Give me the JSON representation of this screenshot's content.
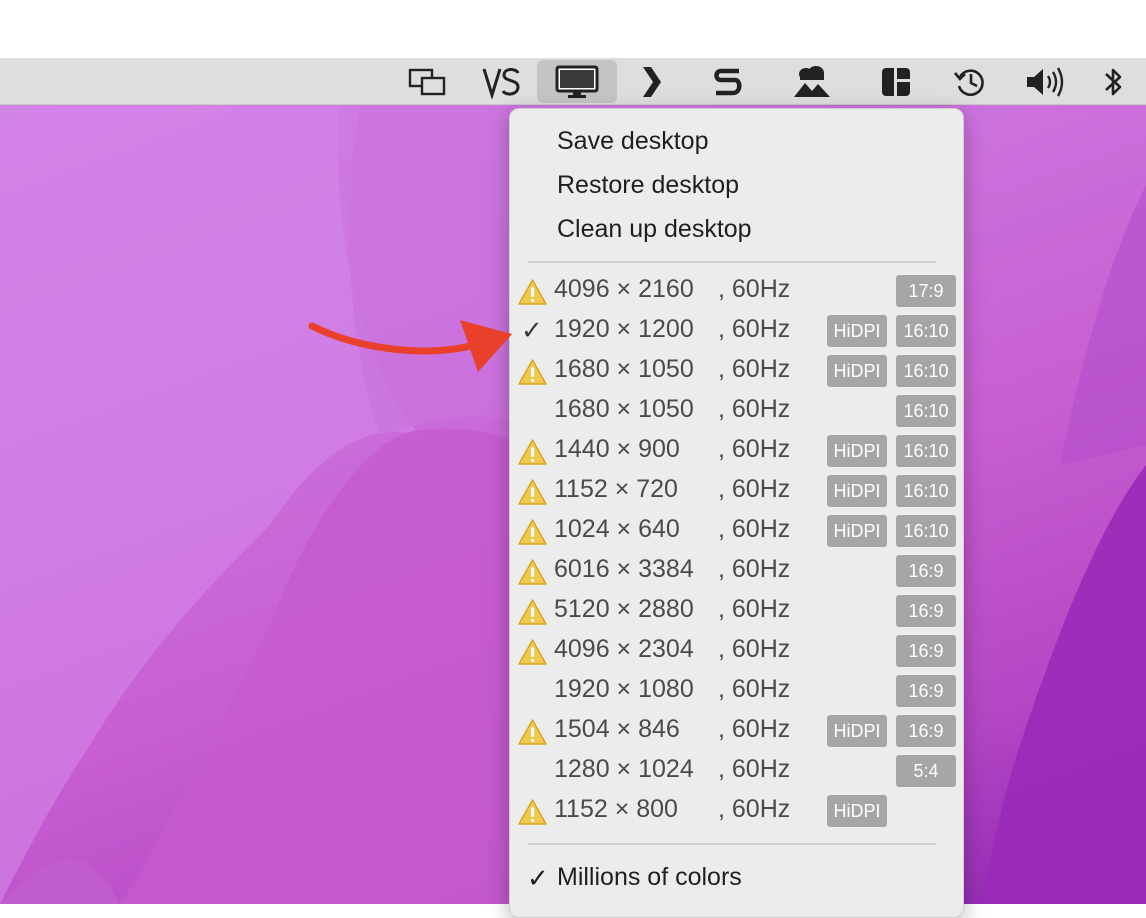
{
  "menubar": {
    "icons": [
      "window-switcher-icon",
      "vnc-icon",
      "display-icon",
      "chevron-right-icon",
      "s-app-icon",
      "cloud-mountain-icon",
      "layout-grid-icon",
      "time-machine-icon",
      "volume-icon",
      "bluetooth-icon"
    ],
    "active_icon": "display-icon"
  },
  "menu": {
    "actions": [
      {
        "label": "Save desktop"
      },
      {
        "label": "Restore desktop"
      },
      {
        "label": "Clean up desktop"
      }
    ],
    "resolutions": [
      {
        "res": "4096 × 2160",
        "hz": ", 60Hz",
        "warning": true,
        "checked": false,
        "hidpi": "",
        "ratio": "17:9"
      },
      {
        "res": "1920 × 1200",
        "hz": ", 60Hz",
        "warning": false,
        "checked": true,
        "hidpi": "HiDPI",
        "ratio": "16:10"
      },
      {
        "res": "1680 × 1050",
        "hz": ", 60Hz",
        "warning": true,
        "checked": false,
        "hidpi": "HiDPI",
        "ratio": "16:10"
      },
      {
        "res": "1680 × 1050",
        "hz": ", 60Hz",
        "warning": false,
        "checked": false,
        "hidpi": "",
        "ratio": "16:10"
      },
      {
        "res": "1440 × 900",
        "hz": ", 60Hz",
        "warning": true,
        "checked": false,
        "hidpi": "HiDPI",
        "ratio": "16:10"
      },
      {
        "res": "1152 × 720",
        "hz": ", 60Hz",
        "warning": true,
        "checked": false,
        "hidpi": "HiDPI",
        "ratio": "16:10"
      },
      {
        "res": "1024 × 640",
        "hz": ", 60Hz",
        "warning": true,
        "checked": false,
        "hidpi": "HiDPI",
        "ratio": "16:10"
      },
      {
        "res": "6016 × 3384",
        "hz": ", 60Hz",
        "warning": true,
        "checked": false,
        "hidpi": "",
        "ratio": "16:9"
      },
      {
        "res": "5120 × 2880",
        "hz": ", 60Hz",
        "warning": true,
        "checked": false,
        "hidpi": "",
        "ratio": "16:9"
      },
      {
        "res": "4096 × 2304",
        "hz": ", 60Hz",
        "warning": true,
        "checked": false,
        "hidpi": "",
        "ratio": "16:9"
      },
      {
        "res": "1920 × 1080",
        "hz": ", 60Hz",
        "warning": false,
        "checked": false,
        "hidpi": "",
        "ratio": "16:9"
      },
      {
        "res": "1504 × 846",
        "hz": ", 60Hz",
        "warning": true,
        "checked": false,
        "hidpi": "HiDPI",
        "ratio": "16:9"
      },
      {
        "res": "1280 × 1024",
        "hz": ", 60Hz",
        "warning": false,
        "checked": false,
        "hidpi": "",
        "ratio": "5:4"
      },
      {
        "res": "1152 × 800",
        "hz": ", 60Hz",
        "warning": true,
        "checked": false,
        "hidpi": "HiDPI",
        "ratio": ""
      }
    ],
    "colors": {
      "label": "Millions of colors",
      "checked": true,
      "check_glyph": "✓"
    },
    "check_glyph": "✓"
  },
  "annotation": {
    "arrow_color": "#e8402a"
  },
  "colors": {
    "menu_bg": "#ececec",
    "badge": "#a6a6a6",
    "warning": "#f2c94c"
  }
}
